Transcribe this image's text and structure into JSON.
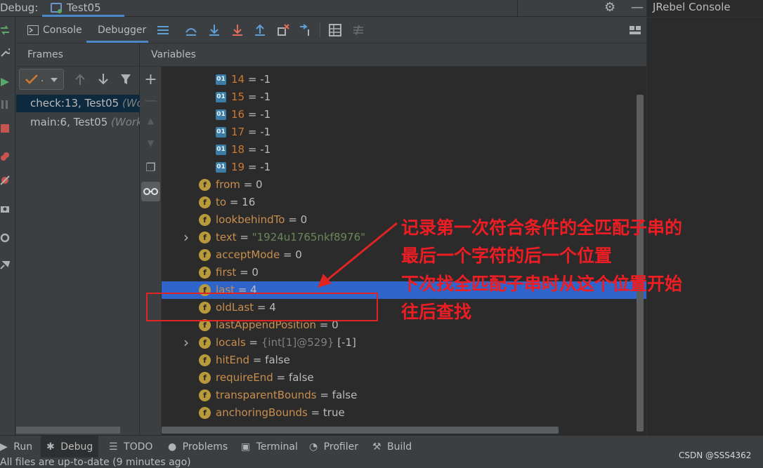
{
  "top": {
    "debug_label": "Debug:",
    "run_tab": "Test05",
    "jrebel": "JRebel Console"
  },
  "toolbar": {
    "console_tab": "Console",
    "debugger_tab": "Debugger"
  },
  "frames": {
    "header": "Frames",
    "thread_value": ".",
    "items": [
      {
        "method": "check:13, Test05",
        "loc": "(Wo"
      },
      {
        "method": "main:6, Test05",
        "loc": "(Work"
      }
    ]
  },
  "variables": {
    "header": "Variables",
    "array_items": [
      {
        "name": "14",
        "eq": " = ",
        "value": "-1"
      },
      {
        "name": "15",
        "eq": " = ",
        "value": "-1"
      },
      {
        "name": "16",
        "eq": " = ",
        "value": "-1"
      },
      {
        "name": "17",
        "eq": " = ",
        "value": "-1"
      },
      {
        "name": "18",
        "eq": " = ",
        "value": "-1"
      },
      {
        "name": "19",
        "eq": " = ",
        "value": "-1"
      }
    ],
    "fields": [
      {
        "name": "from",
        "eq": " = ",
        "value": "0"
      },
      {
        "name": "to",
        "eq": " = ",
        "value": "16"
      },
      {
        "name": "lookbehindTo",
        "eq": " = ",
        "value": "0"
      },
      {
        "name": "text",
        "eq": " = ",
        "value": "\"1924u1765nkf8976\""
      },
      {
        "name": "acceptMode",
        "eq": " = ",
        "value": "0"
      },
      {
        "name": "first",
        "eq": " = ",
        "value": "0"
      },
      {
        "name": "last",
        "eq": " = ",
        "value": "4"
      },
      {
        "name": "oldLast",
        "eq": " = ",
        "value": "4"
      },
      {
        "name": "lastAppendPosition",
        "eq": " = ",
        "value": "0"
      },
      {
        "name": "locals",
        "eq": " = ",
        "meta": "{int[1]@529}",
        "value": " [-1]"
      },
      {
        "name": "hitEnd",
        "eq": " = ",
        "value": "false"
      },
      {
        "name": "requireEnd",
        "eq": " = ",
        "value": "false"
      },
      {
        "name": "transparentBounds",
        "eq": " = ",
        "value": "false"
      },
      {
        "name": "anchoringBounds",
        "eq": " = ",
        "value": "true"
      }
    ],
    "array_badge": "01",
    "field_badge": "f"
  },
  "annotation": {
    "lines": [
      "记录第一次符合条件的全匹配子串的",
      "最后一个字符的后一个位置",
      "下次找全匹配子串时从这个位置开始",
      "往后查找"
    ],
    "color": "#ee1d24"
  },
  "bottom": {
    "run": "Run",
    "debug": "Debug",
    "todo": "TODO",
    "problems": "Problems",
    "terminal": "Terminal",
    "profiler": "Profiler",
    "build": "Build",
    "status": "All files are up-to-date (9 minutes ago)",
    "watermark": "CSDN @SSS4362"
  }
}
